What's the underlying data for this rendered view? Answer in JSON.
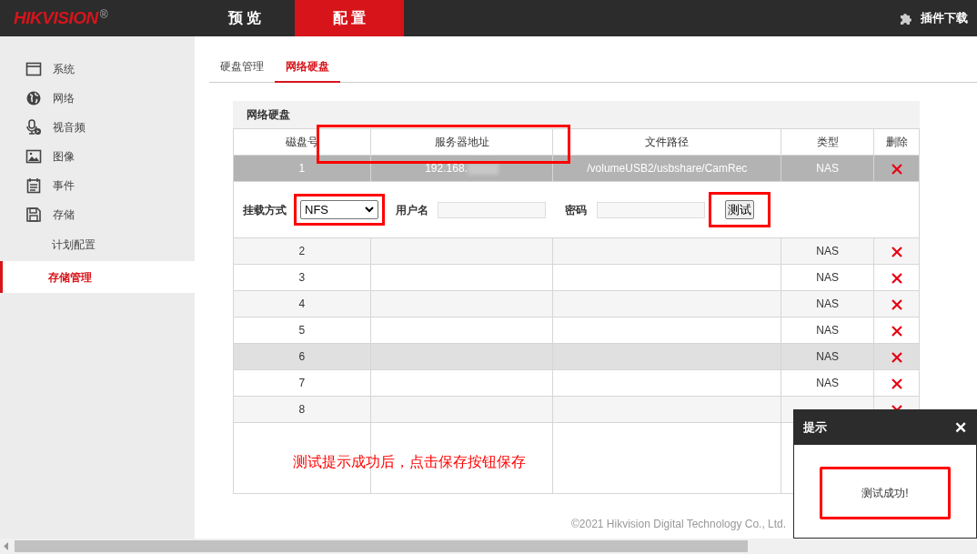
{
  "header": {
    "logo": "HIKVISION",
    "logo_mark": "®",
    "tabs": [
      {
        "label": "预 览",
        "selected": false
      },
      {
        "label": "配 置",
        "selected": true
      }
    ],
    "plugin": "插件下载"
  },
  "sidebar": {
    "items": [
      {
        "label": "系统",
        "selected": false
      },
      {
        "label": "网络",
        "selected": false
      },
      {
        "label": "视音频",
        "selected": false
      },
      {
        "label": "图像",
        "selected": false
      },
      {
        "label": "事件",
        "selected": false
      },
      {
        "label": "存储",
        "selected": false,
        "children": [
          {
            "label": "计划配置",
            "selected": false
          },
          {
            "label": "存储管理",
            "selected": true
          }
        ]
      }
    ]
  },
  "subtabs": [
    {
      "label": "硬盘管理",
      "selected": false
    },
    {
      "label": "网络硬盘",
      "selected": true
    }
  ],
  "panel": {
    "title": "网络硬盘",
    "columns": [
      "磁盘号",
      "服务器地址",
      "文件路径",
      "类型",
      "删除"
    ],
    "address_path_highlighted": true,
    "rows": [
      {
        "number": "1",
        "address": "192.168.",
        "redacted": true,
        "path": "/volumeUSB2/usbshare/CamRec",
        "type": "NAS",
        "selected": true
      },
      {
        "number": "2",
        "type": "NAS",
        "selected": false
      },
      {
        "number": "3",
        "type": "NAS",
        "selected": false
      },
      {
        "number": "4",
        "type": "NAS",
        "selected": false
      },
      {
        "number": "5",
        "type": "NAS",
        "selected": false
      },
      {
        "number": "6",
        "type": "NAS",
        "selected": false,
        "hovered": true
      },
      {
        "number": "7",
        "type": "NAS",
        "selected": false
      },
      {
        "number": "8",
        "selected": false
      }
    ],
    "mount": {
      "label": "挂载方式",
      "value": "NFS",
      "highlighted": true,
      "username_label": "用户名",
      "password_label": "密码",
      "test_button": "测试",
      "test_highlighted": true
    },
    "annotation": "测试提示成功后，点击保存按钮保存"
  },
  "footer": "©2021 Hikvision Digital Technology Co., Ltd.",
  "dialog": {
    "title": "提示",
    "close": "✕",
    "message": "测试成功!",
    "highlighted": true
  }
}
